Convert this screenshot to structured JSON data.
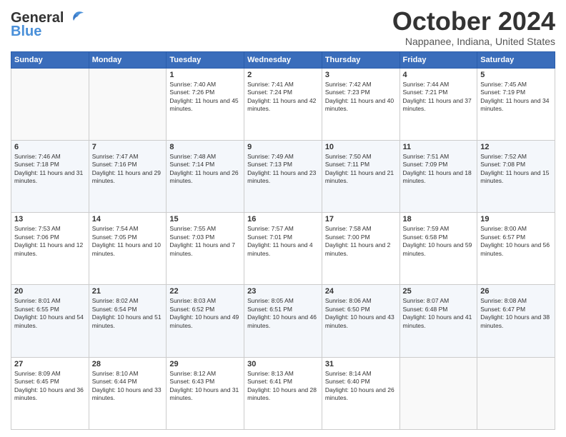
{
  "header": {
    "logo_line1": "General",
    "logo_line2": "Blue",
    "month": "October 2024",
    "location": "Nappanee, Indiana, United States"
  },
  "days_of_week": [
    "Sunday",
    "Monday",
    "Tuesday",
    "Wednesday",
    "Thursday",
    "Friday",
    "Saturday"
  ],
  "weeks": [
    [
      {
        "day": "",
        "info": ""
      },
      {
        "day": "",
        "info": ""
      },
      {
        "day": "1",
        "info": "Sunrise: 7:40 AM\nSunset: 7:26 PM\nDaylight: 11 hours and 45 minutes."
      },
      {
        "day": "2",
        "info": "Sunrise: 7:41 AM\nSunset: 7:24 PM\nDaylight: 11 hours and 42 minutes."
      },
      {
        "day": "3",
        "info": "Sunrise: 7:42 AM\nSunset: 7:23 PM\nDaylight: 11 hours and 40 minutes."
      },
      {
        "day": "4",
        "info": "Sunrise: 7:44 AM\nSunset: 7:21 PM\nDaylight: 11 hours and 37 minutes."
      },
      {
        "day": "5",
        "info": "Sunrise: 7:45 AM\nSunset: 7:19 PM\nDaylight: 11 hours and 34 minutes."
      }
    ],
    [
      {
        "day": "6",
        "info": "Sunrise: 7:46 AM\nSunset: 7:18 PM\nDaylight: 11 hours and 31 minutes."
      },
      {
        "day": "7",
        "info": "Sunrise: 7:47 AM\nSunset: 7:16 PM\nDaylight: 11 hours and 29 minutes."
      },
      {
        "day": "8",
        "info": "Sunrise: 7:48 AM\nSunset: 7:14 PM\nDaylight: 11 hours and 26 minutes."
      },
      {
        "day": "9",
        "info": "Sunrise: 7:49 AM\nSunset: 7:13 PM\nDaylight: 11 hours and 23 minutes."
      },
      {
        "day": "10",
        "info": "Sunrise: 7:50 AM\nSunset: 7:11 PM\nDaylight: 11 hours and 21 minutes."
      },
      {
        "day": "11",
        "info": "Sunrise: 7:51 AM\nSunset: 7:09 PM\nDaylight: 11 hours and 18 minutes."
      },
      {
        "day": "12",
        "info": "Sunrise: 7:52 AM\nSunset: 7:08 PM\nDaylight: 11 hours and 15 minutes."
      }
    ],
    [
      {
        "day": "13",
        "info": "Sunrise: 7:53 AM\nSunset: 7:06 PM\nDaylight: 11 hours and 12 minutes."
      },
      {
        "day": "14",
        "info": "Sunrise: 7:54 AM\nSunset: 7:05 PM\nDaylight: 11 hours and 10 minutes."
      },
      {
        "day": "15",
        "info": "Sunrise: 7:55 AM\nSunset: 7:03 PM\nDaylight: 11 hours and 7 minutes."
      },
      {
        "day": "16",
        "info": "Sunrise: 7:57 AM\nSunset: 7:01 PM\nDaylight: 11 hours and 4 minutes."
      },
      {
        "day": "17",
        "info": "Sunrise: 7:58 AM\nSunset: 7:00 PM\nDaylight: 11 hours and 2 minutes."
      },
      {
        "day": "18",
        "info": "Sunrise: 7:59 AM\nSunset: 6:58 PM\nDaylight: 10 hours and 59 minutes."
      },
      {
        "day": "19",
        "info": "Sunrise: 8:00 AM\nSunset: 6:57 PM\nDaylight: 10 hours and 56 minutes."
      }
    ],
    [
      {
        "day": "20",
        "info": "Sunrise: 8:01 AM\nSunset: 6:55 PM\nDaylight: 10 hours and 54 minutes."
      },
      {
        "day": "21",
        "info": "Sunrise: 8:02 AM\nSunset: 6:54 PM\nDaylight: 10 hours and 51 minutes."
      },
      {
        "day": "22",
        "info": "Sunrise: 8:03 AM\nSunset: 6:52 PM\nDaylight: 10 hours and 49 minutes."
      },
      {
        "day": "23",
        "info": "Sunrise: 8:05 AM\nSunset: 6:51 PM\nDaylight: 10 hours and 46 minutes."
      },
      {
        "day": "24",
        "info": "Sunrise: 8:06 AM\nSunset: 6:50 PM\nDaylight: 10 hours and 43 minutes."
      },
      {
        "day": "25",
        "info": "Sunrise: 8:07 AM\nSunset: 6:48 PM\nDaylight: 10 hours and 41 minutes."
      },
      {
        "day": "26",
        "info": "Sunrise: 8:08 AM\nSunset: 6:47 PM\nDaylight: 10 hours and 38 minutes."
      }
    ],
    [
      {
        "day": "27",
        "info": "Sunrise: 8:09 AM\nSunset: 6:45 PM\nDaylight: 10 hours and 36 minutes."
      },
      {
        "day": "28",
        "info": "Sunrise: 8:10 AM\nSunset: 6:44 PM\nDaylight: 10 hours and 33 minutes."
      },
      {
        "day": "29",
        "info": "Sunrise: 8:12 AM\nSunset: 6:43 PM\nDaylight: 10 hours and 31 minutes."
      },
      {
        "day": "30",
        "info": "Sunrise: 8:13 AM\nSunset: 6:41 PM\nDaylight: 10 hours and 28 minutes."
      },
      {
        "day": "31",
        "info": "Sunrise: 8:14 AM\nSunset: 6:40 PM\nDaylight: 10 hours and 26 minutes."
      },
      {
        "day": "",
        "info": ""
      },
      {
        "day": "",
        "info": ""
      }
    ]
  ]
}
